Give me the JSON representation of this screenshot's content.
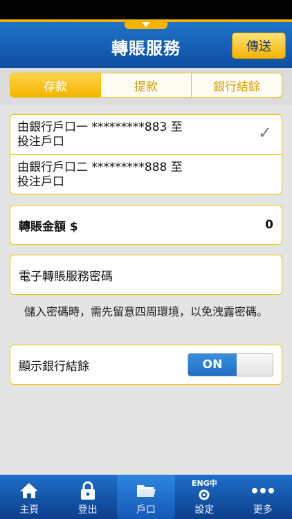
{
  "header": {
    "title": "轉賬服務",
    "send_label": "傳送"
  },
  "tabs": [
    {
      "label": "存款",
      "active": true
    },
    {
      "label": "提款",
      "active": false
    },
    {
      "label": "銀行結餘",
      "active": false
    }
  ],
  "accounts": [
    {
      "line1": "由銀行戶口一 *********883 至",
      "line2": "投注戶口",
      "selected": true
    },
    {
      "line1": "由銀行戶口二 *********888 至",
      "line2": "投注戶口",
      "selected": false
    }
  ],
  "amount": {
    "label": "轉賬金額 $",
    "value": "0"
  },
  "password": {
    "label": "電子轉賬服務密碼"
  },
  "notice": "儲入密碼時，需先留意四周環境，以免洩露密碼。",
  "balance_toggle": {
    "label": "顯示銀行結餘",
    "state": "ON"
  },
  "nav": [
    {
      "label": "主頁",
      "icon": "home-icon"
    },
    {
      "label": "登出",
      "icon": "lock-icon"
    },
    {
      "label": "戶口",
      "icon": "folder-icon",
      "active": true
    },
    {
      "label": "設定",
      "icon": "settings-icon",
      "icon_text": "ENG中"
    },
    {
      "label": "更多",
      "icon": "more-icon"
    }
  ],
  "colors": {
    "primary_blue": "#0d4ea3",
    "accent_yellow": "#f4b400"
  }
}
